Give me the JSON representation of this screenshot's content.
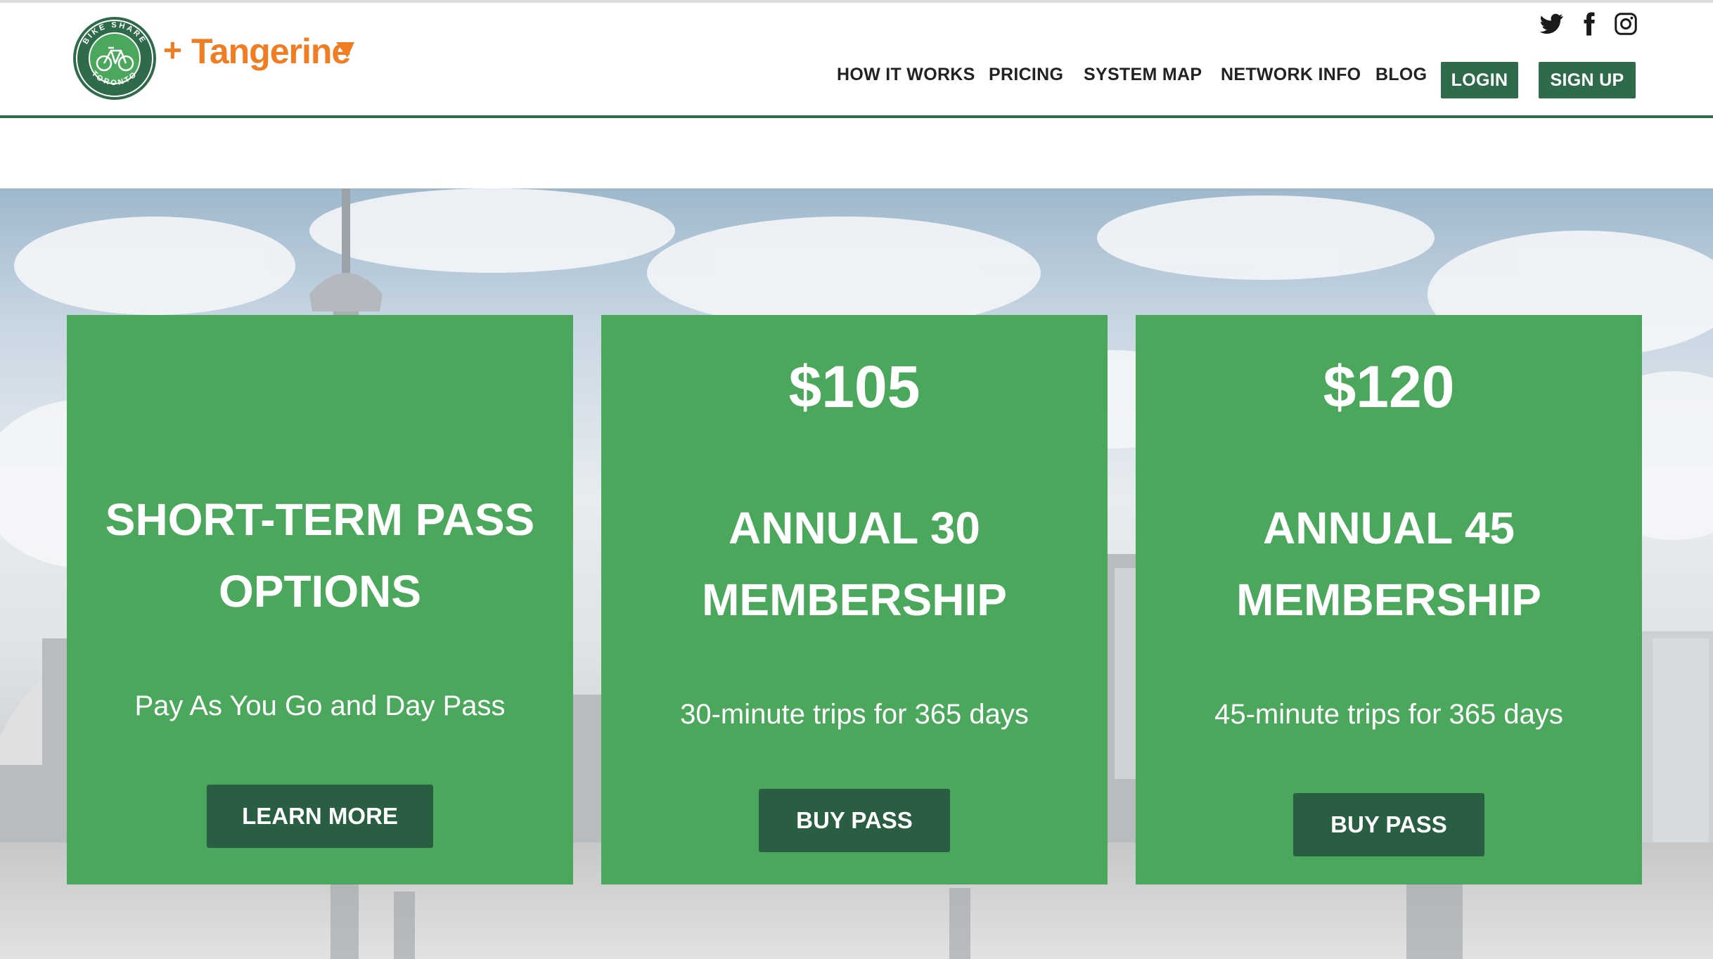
{
  "header": {
    "logo": {
      "badge_text_top": "BIKE SHARE",
      "badge_text_bottom": "TORONTO",
      "plus": "+",
      "partner_name": "Tangerine",
      "brand_green": "#2f6b4a",
      "partner_orange": "#f07d22"
    },
    "social": [
      "twitter-icon",
      "facebook-icon",
      "instagram-icon"
    ],
    "nav": {
      "how_it_works": "HOW IT WORKS",
      "pricing": "PRICING",
      "system_map": "SYSTEM MAP",
      "network_info": "NETWORK INFO",
      "blog": "BLOG"
    },
    "login_label": "LOGIN",
    "signup_label": "SIGN UP"
  },
  "cards": [
    {
      "price": "",
      "title_line1": "SHORT-TERM PASS",
      "title_line2": "OPTIONS",
      "subtitle": "Pay As You Go and Day Pass",
      "button": "LEARN MORE"
    },
    {
      "price": "$105",
      "title_line1": "ANNUAL 30",
      "title_line2": "MEMBERSHIP",
      "subtitle": "30-minute trips for 365 days",
      "button": "BUY PASS"
    },
    {
      "price": "$120",
      "title_line1": "ANNUAL 45",
      "title_line2": "MEMBERSHIP",
      "subtitle": "45-minute trips for 365 days",
      "button": "BUY PASS"
    }
  ],
  "colors": {
    "card_green": "#4ba75c",
    "button_dark_green": "#2a5e42"
  }
}
